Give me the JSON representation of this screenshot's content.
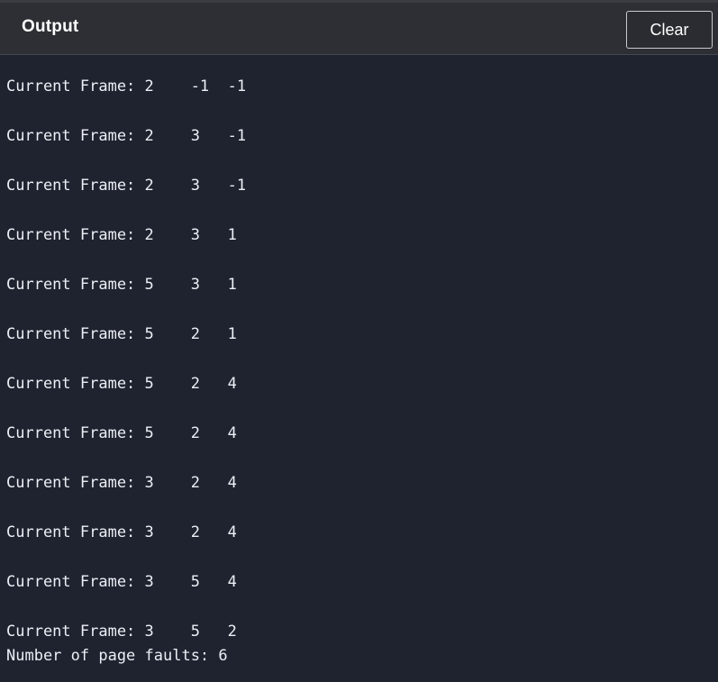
{
  "header": {
    "title": "Output",
    "clear_label": "Clear"
  },
  "output": {
    "lines": [
      "Current Frame: 2    -1  -1",
      "Current Frame: 2    3   -1",
      "Current Frame: 2    3   -1",
      "Current Frame: 2    3   1",
      "Current Frame: 5    3   1",
      "Current Frame: 5    2   1",
      "Current Frame: 5    2   4",
      "Current Frame: 5    2   4",
      "Current Frame: 3    2   4",
      "Current Frame: 3    2   4",
      "Current Frame: 3    5   4",
      "Current Frame: 3    5   2",
      "Number of page faults: 6"
    ]
  },
  "colors": {
    "background": "#1f2330",
    "header_background": "#2d2f34",
    "text": "#eceff4"
  }
}
